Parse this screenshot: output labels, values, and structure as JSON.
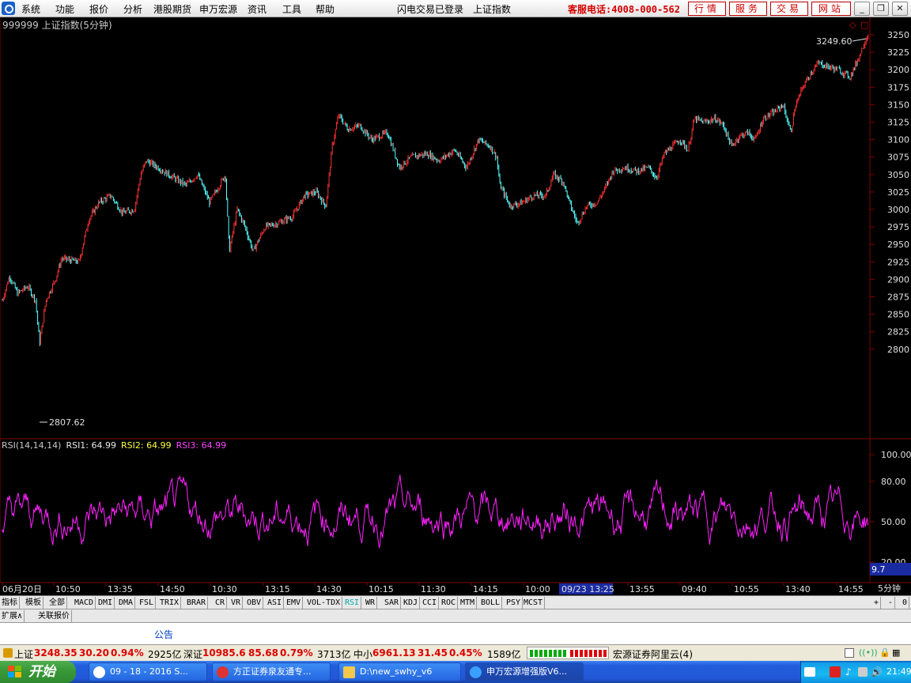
{
  "menu": {
    "items": [
      "系统",
      "功能",
      "报价",
      "分析",
      "港股期货",
      "申万宏源",
      "资讯",
      "工具",
      "帮助"
    ],
    "status": "闪电交易已登录",
    "index_name": "上证指数",
    "hotline": "客服电话:4008-000-562",
    "buttons": [
      "行情",
      "服务",
      "交易",
      "网站"
    ]
  },
  "price_chart": {
    "title": "999999 上证指数(5分钟)",
    "high_label": "3249.60",
    "low_label": "2807.62",
    "y_ticks": [
      "3250",
      "3225",
      "3200",
      "3175",
      "3150",
      "3125",
      "3100",
      "3075",
      "3050",
      "3025",
      "3000",
      "2975",
      "2950",
      "2925",
      "2900",
      "2875",
      "2850",
      "2825",
      "2800"
    ],
    "colors": {
      "up": "#ff3232",
      "down": "#54ffff",
      "grid": "#800000"
    }
  },
  "rsi": {
    "label": "RSI(14,14,14)",
    "rsi1": "RSI1: 64.99",
    "rsi2": "RSI2: 64.99",
    "rsi3": "RSI3: 64.99",
    "y_ticks": [
      "100.00",
      "80.00",
      "50.00",
      "20.00"
    ],
    "current": "9.7",
    "color": "#ff22ff"
  },
  "time_axis": {
    "labels": [
      "06月20日",
      "10:50",
      "13:35",
      "14:50",
      "10:30",
      "13:15",
      "14:30",
      "10:15",
      "11:30",
      "14:15",
      "10:00",
      "09/23 13:25",
      "13:55",
      "09:40",
      "10:55",
      "13:40",
      "14:55"
    ],
    "period": "5分钟"
  },
  "indicator_tabs": [
    "指标",
    "模板",
    "全部",
    "MACD",
    "DMI",
    "DMA",
    "FSL",
    "TRIX",
    "BRAR",
    "CR",
    "VR",
    "OBV",
    "ASI",
    "EMV",
    "VOL-TDX",
    "RSI",
    "WR",
    "SAR",
    "KDJ",
    "CCI",
    "ROC",
    "MTM",
    "BOLL",
    "PSY",
    "MCST"
  ],
  "tab_controls": [
    "+",
    "-",
    "0"
  ],
  "sub_tabs": [
    "扩展∧",
    "关联报价"
  ],
  "announcement": "公告",
  "status": {
    "sh_label": "上证",
    "sh_value": "3248.35",
    "sh_change": "30.20",
    "sh_pct": "0.94%",
    "sh_amount": "2925亿",
    "sz_label": "深证",
    "sz_value": "10985.6",
    "sz_change": "85.68",
    "sz_pct": "0.79%",
    "sz_amount": "3713亿",
    "zx_label": "中小",
    "zx_value": "6961.13",
    "zx_change": "31.45",
    "zx_pct": "0.45%",
    "zx_amount": "1589亿",
    "server": "宏源证券阿里云(4)"
  },
  "taskbar": {
    "start": "开始",
    "tasks": [
      "09 - 18 - 2016 S...",
      "方正证券泉友通专...",
      "D:\\new_swhy_v6",
      "申万宏源增强版V6..."
    ],
    "clock": "21:49"
  }
}
